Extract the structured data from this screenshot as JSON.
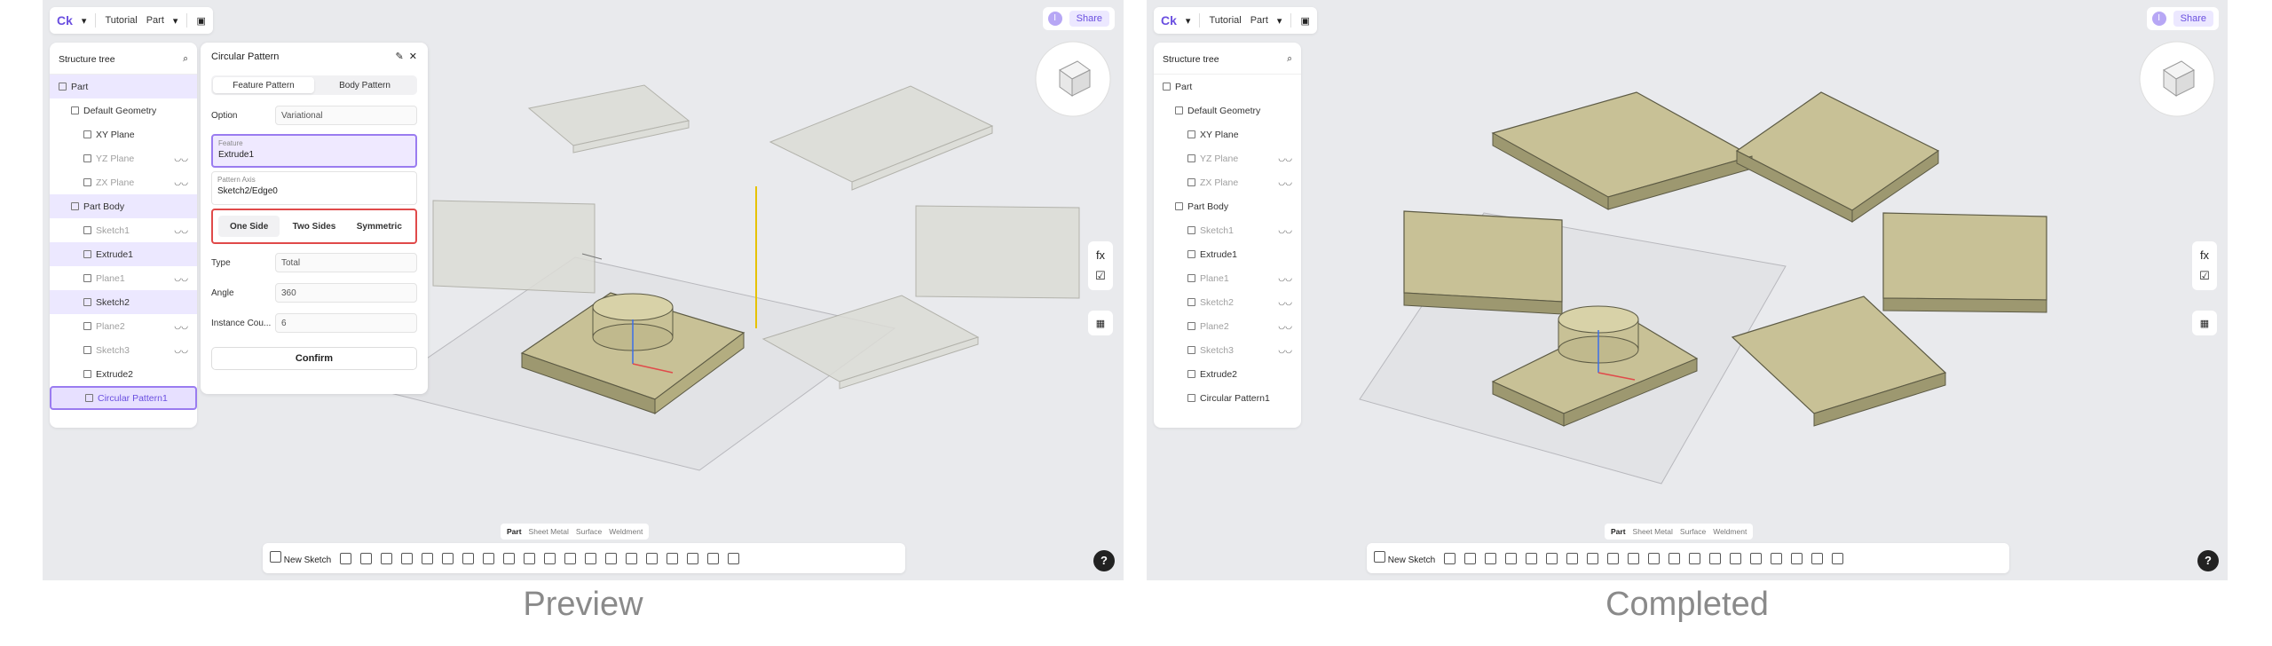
{
  "app": {
    "logo": "Ck",
    "menu": [
      "Tutorial",
      "Part"
    ]
  },
  "header": {
    "share": "Share",
    "user": "I"
  },
  "tree": {
    "title": "Structure tree",
    "items": [
      {
        "label": "Part",
        "indent": 0,
        "state": "sel"
      },
      {
        "label": "Default Geometry",
        "indent": 1,
        "state": "normal"
      },
      {
        "label": "XY Plane",
        "indent": 2,
        "state": "normal"
      },
      {
        "label": "YZ Plane",
        "indent": 2,
        "state": "dim",
        "eye": true
      },
      {
        "label": "ZX Plane",
        "indent": 2,
        "state": "dim",
        "eye": true
      },
      {
        "label": "Part Body",
        "indent": 1,
        "state": "sel"
      },
      {
        "label": "Sketch1",
        "indent": 2,
        "state": "dim",
        "eye": true
      },
      {
        "label": "Extrude1",
        "indent": 2,
        "state": "sel"
      },
      {
        "label": "Plane1",
        "indent": 2,
        "state": "dim",
        "eye": true
      },
      {
        "label": "Sketch2",
        "indent": 2,
        "state": "sel"
      },
      {
        "label": "Plane2",
        "indent": 2,
        "state": "dim",
        "eye": true
      },
      {
        "label": "Sketch3",
        "indent": 2,
        "state": "dim",
        "eye": true
      },
      {
        "label": "Extrude2",
        "indent": 2,
        "state": "normal"
      },
      {
        "label": "Circular Pattern1",
        "indent": 2,
        "state": "active"
      }
    ],
    "items_done": [
      {
        "label": "Part",
        "indent": 0,
        "state": "normal"
      },
      {
        "label": "Default Geometry",
        "indent": 1,
        "state": "normal"
      },
      {
        "label": "XY Plane",
        "indent": 2,
        "state": "normal"
      },
      {
        "label": "YZ Plane",
        "indent": 2,
        "state": "dim",
        "eye": true
      },
      {
        "label": "ZX Plane",
        "indent": 2,
        "state": "dim",
        "eye": true
      },
      {
        "label": "Part Body",
        "indent": 1,
        "state": "normal"
      },
      {
        "label": "Sketch1",
        "indent": 2,
        "state": "dim",
        "eye": true
      },
      {
        "label": "Extrude1",
        "indent": 2,
        "state": "normal"
      },
      {
        "label": "Plane1",
        "indent": 2,
        "state": "dim",
        "eye": true
      },
      {
        "label": "Sketch2",
        "indent": 2,
        "state": "dim",
        "eye": true
      },
      {
        "label": "Plane2",
        "indent": 2,
        "state": "dim",
        "eye": true
      },
      {
        "label": "Sketch3",
        "indent": 2,
        "state": "dim",
        "eye": true
      },
      {
        "label": "Extrude2",
        "indent": 2,
        "state": "normal"
      },
      {
        "label": "Circular Pattern1",
        "indent": 2,
        "state": "normal"
      }
    ]
  },
  "dialog": {
    "title": "Circular Pattern",
    "tabs": [
      "Feature Pattern",
      "Body Pattern"
    ],
    "option_label": "Option",
    "option_value": "Variational",
    "feature_label": "Feature",
    "feature_value": "Extrude1",
    "axis_label": "Pattern Axis",
    "axis_value": "Sketch2/Edge0",
    "directions": [
      "One Side",
      "Two Sides",
      "Symmetric"
    ],
    "type_label": "Type",
    "type_value": "Total",
    "angle_label": "Angle",
    "angle_value": "360",
    "count_label": "Instance Cou...",
    "count_value": "6",
    "confirm": "Confirm"
  },
  "modes": [
    "Part",
    "Sheet Metal",
    "Surface",
    "Weldment"
  ],
  "toolbar": {
    "new_sketch": "New Sketch"
  },
  "side": {
    "fx": "fx"
  },
  "captions": {
    "left": "Preview",
    "right": "Completed"
  },
  "colors": {
    "accent": "#6a4fe0",
    "highlight": "#e04a4a",
    "solid": "#c8c196"
  }
}
